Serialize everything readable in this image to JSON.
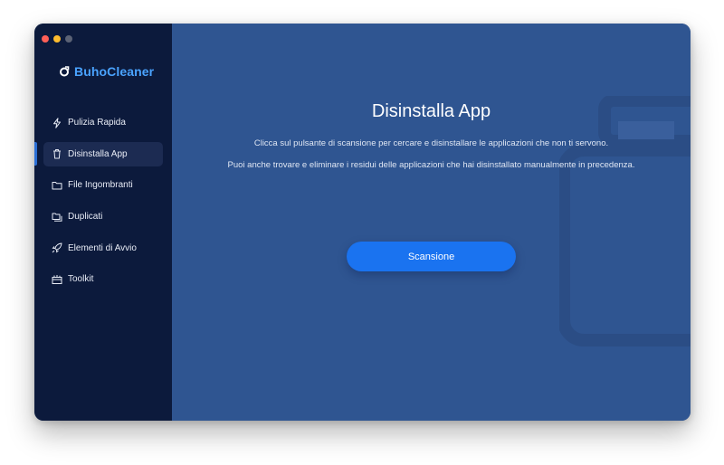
{
  "app": {
    "name": "BuhoCleaner",
    "brand_color": "#4aa3ff",
    "logo_icon": "buho-logo-icon"
  },
  "window_controls": {
    "close_color": "#ff5f57",
    "minimize_color": "#febc2e",
    "zoom_color": "#5b6275"
  },
  "sidebar": {
    "items": [
      {
        "label": "Pulizia Rapida",
        "icon": "lightning-icon",
        "active": false
      },
      {
        "label": "Disinstalla App",
        "icon": "trash-icon",
        "active": true
      },
      {
        "label": "File Ingombranti",
        "icon": "folder-icon",
        "active": false
      },
      {
        "label": "Duplicati",
        "icon": "duplicate-folder-icon",
        "active": false
      },
      {
        "label": "Elementi di Avvio",
        "icon": "rocket-icon",
        "active": false
      },
      {
        "label": "Toolkit",
        "icon": "toolbox-icon",
        "active": false
      }
    ]
  },
  "main": {
    "title": "Disinstalla App",
    "description_1": "Clicca sul pulsante di scansione per cercare e disinstallare le applicazioni che non ti servono.",
    "description_2": "Puoi anche trovare e eliminare i residui delle applicazioni che hai disinstallato manualmente in precedenza.",
    "scan_button_label": "Scansione",
    "illustration_icon": "trash-bin-illustration"
  },
  "colors": {
    "sidebar_bg": "#0c1a3c",
    "main_bg": "#2f5591",
    "accent": "#1a73f0",
    "active_item_bg": "#1c2b52"
  }
}
